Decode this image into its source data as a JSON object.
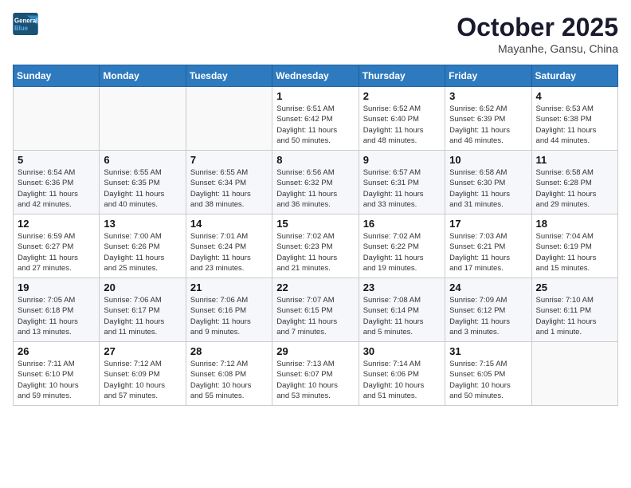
{
  "logo": {
    "line1": "General",
    "line2": "Blue"
  },
  "title": "October 2025",
  "location": "Mayanhe, Gansu, China",
  "weekdays": [
    "Sunday",
    "Monday",
    "Tuesday",
    "Wednesday",
    "Thursday",
    "Friday",
    "Saturday"
  ],
  "weeks": [
    [
      {
        "day": "",
        "info": ""
      },
      {
        "day": "",
        "info": ""
      },
      {
        "day": "",
        "info": ""
      },
      {
        "day": "1",
        "info": "Sunrise: 6:51 AM\nSunset: 6:42 PM\nDaylight: 11 hours\nand 50 minutes."
      },
      {
        "day": "2",
        "info": "Sunrise: 6:52 AM\nSunset: 6:40 PM\nDaylight: 11 hours\nand 48 minutes."
      },
      {
        "day": "3",
        "info": "Sunrise: 6:52 AM\nSunset: 6:39 PM\nDaylight: 11 hours\nand 46 minutes."
      },
      {
        "day": "4",
        "info": "Sunrise: 6:53 AM\nSunset: 6:38 PM\nDaylight: 11 hours\nand 44 minutes."
      }
    ],
    [
      {
        "day": "5",
        "info": "Sunrise: 6:54 AM\nSunset: 6:36 PM\nDaylight: 11 hours\nand 42 minutes."
      },
      {
        "day": "6",
        "info": "Sunrise: 6:55 AM\nSunset: 6:35 PM\nDaylight: 11 hours\nand 40 minutes."
      },
      {
        "day": "7",
        "info": "Sunrise: 6:55 AM\nSunset: 6:34 PM\nDaylight: 11 hours\nand 38 minutes."
      },
      {
        "day": "8",
        "info": "Sunrise: 6:56 AM\nSunset: 6:32 PM\nDaylight: 11 hours\nand 36 minutes."
      },
      {
        "day": "9",
        "info": "Sunrise: 6:57 AM\nSunset: 6:31 PM\nDaylight: 11 hours\nand 33 minutes."
      },
      {
        "day": "10",
        "info": "Sunrise: 6:58 AM\nSunset: 6:30 PM\nDaylight: 11 hours\nand 31 minutes."
      },
      {
        "day": "11",
        "info": "Sunrise: 6:58 AM\nSunset: 6:28 PM\nDaylight: 11 hours\nand 29 minutes."
      }
    ],
    [
      {
        "day": "12",
        "info": "Sunrise: 6:59 AM\nSunset: 6:27 PM\nDaylight: 11 hours\nand 27 minutes."
      },
      {
        "day": "13",
        "info": "Sunrise: 7:00 AM\nSunset: 6:26 PM\nDaylight: 11 hours\nand 25 minutes."
      },
      {
        "day": "14",
        "info": "Sunrise: 7:01 AM\nSunset: 6:24 PM\nDaylight: 11 hours\nand 23 minutes."
      },
      {
        "day": "15",
        "info": "Sunrise: 7:02 AM\nSunset: 6:23 PM\nDaylight: 11 hours\nand 21 minutes."
      },
      {
        "day": "16",
        "info": "Sunrise: 7:02 AM\nSunset: 6:22 PM\nDaylight: 11 hours\nand 19 minutes."
      },
      {
        "day": "17",
        "info": "Sunrise: 7:03 AM\nSunset: 6:21 PM\nDaylight: 11 hours\nand 17 minutes."
      },
      {
        "day": "18",
        "info": "Sunrise: 7:04 AM\nSunset: 6:19 PM\nDaylight: 11 hours\nand 15 minutes."
      }
    ],
    [
      {
        "day": "19",
        "info": "Sunrise: 7:05 AM\nSunset: 6:18 PM\nDaylight: 11 hours\nand 13 minutes."
      },
      {
        "day": "20",
        "info": "Sunrise: 7:06 AM\nSunset: 6:17 PM\nDaylight: 11 hours\nand 11 minutes."
      },
      {
        "day": "21",
        "info": "Sunrise: 7:06 AM\nSunset: 6:16 PM\nDaylight: 11 hours\nand 9 minutes."
      },
      {
        "day": "22",
        "info": "Sunrise: 7:07 AM\nSunset: 6:15 PM\nDaylight: 11 hours\nand 7 minutes."
      },
      {
        "day": "23",
        "info": "Sunrise: 7:08 AM\nSunset: 6:14 PM\nDaylight: 11 hours\nand 5 minutes."
      },
      {
        "day": "24",
        "info": "Sunrise: 7:09 AM\nSunset: 6:12 PM\nDaylight: 11 hours\nand 3 minutes."
      },
      {
        "day": "25",
        "info": "Sunrise: 7:10 AM\nSunset: 6:11 PM\nDaylight: 11 hours\nand 1 minute."
      }
    ],
    [
      {
        "day": "26",
        "info": "Sunrise: 7:11 AM\nSunset: 6:10 PM\nDaylight: 10 hours\nand 59 minutes."
      },
      {
        "day": "27",
        "info": "Sunrise: 7:12 AM\nSunset: 6:09 PM\nDaylight: 10 hours\nand 57 minutes."
      },
      {
        "day": "28",
        "info": "Sunrise: 7:12 AM\nSunset: 6:08 PM\nDaylight: 10 hours\nand 55 minutes."
      },
      {
        "day": "29",
        "info": "Sunrise: 7:13 AM\nSunset: 6:07 PM\nDaylight: 10 hours\nand 53 minutes."
      },
      {
        "day": "30",
        "info": "Sunrise: 7:14 AM\nSunset: 6:06 PM\nDaylight: 10 hours\nand 51 minutes."
      },
      {
        "day": "31",
        "info": "Sunrise: 7:15 AM\nSunset: 6:05 PM\nDaylight: 10 hours\nand 50 minutes."
      },
      {
        "day": "",
        "info": ""
      }
    ]
  ]
}
